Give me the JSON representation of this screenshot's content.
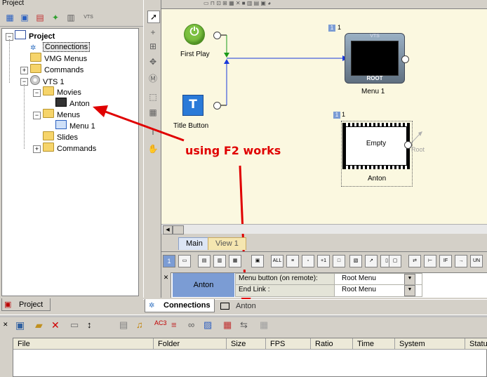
{
  "project_panel": {
    "title": "Project",
    "tab_label": "Project",
    "tree": [
      {
        "label": "Project",
        "bold": true
      },
      {
        "label": "Connections",
        "selected": true
      },
      {
        "label": "VMG Menus"
      },
      {
        "label": "Commands"
      },
      {
        "label": "VTS 1"
      },
      {
        "label": "Movies"
      },
      {
        "label": "Anton"
      },
      {
        "label": "Menus"
      },
      {
        "label": "Menu 1"
      },
      {
        "label": "Slides"
      },
      {
        "label": "Commands"
      }
    ]
  },
  "canvas": {
    "first_play_label": "First Play",
    "title_button_label": "Title Button",
    "vts_label": "VTS",
    "root_label": "ROOT",
    "menu1_label": "Menu 1",
    "menu1_badge": "1",
    "menu1_number": "1",
    "empty_label": "Empty",
    "anton_label": "Anton",
    "anton_badge": "1",
    "anton_number": "1",
    "root_link_label": "Root"
  },
  "view_tabs": {
    "main": "Main",
    "view1": "View 1"
  },
  "properties": {
    "object_name": "Anton",
    "rows": [
      {
        "label": "Menu button (on remote):",
        "value": "Root Menu"
      },
      {
        "label": "End Link :",
        "value": "Root Menu"
      }
    ]
  },
  "doc_tabs": {
    "connections": "Connections",
    "anton": "Anton"
  },
  "file_table": {
    "columns": [
      "File",
      "Folder",
      "Size",
      "FPS",
      "Ratio",
      "Time",
      "System",
      "Status"
    ]
  },
  "annotation": {
    "text": "using F2 works",
    "color": "#e00000"
  },
  "colors": {
    "canvas_bg": "#fbf8e0",
    "selected_cell": "#7b9cd4",
    "play_green": "#7cc040",
    "title_blue": "#2a7ad8"
  }
}
